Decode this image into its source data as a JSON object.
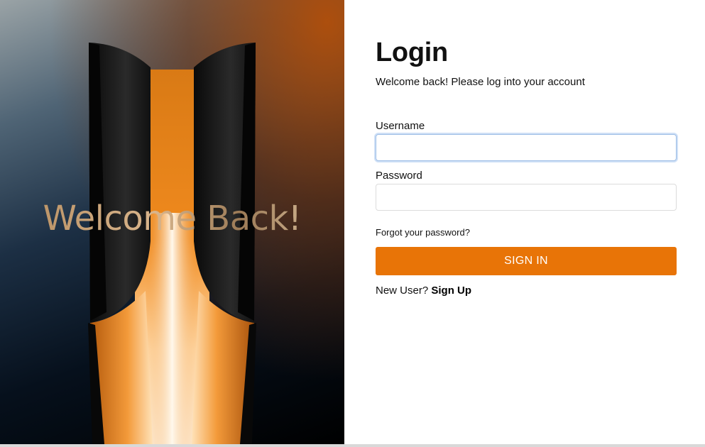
{
  "hero": {
    "title": "Welcome Back!"
  },
  "login": {
    "title": "Login",
    "subtitle": "Welcome back! Please log into your account",
    "username_label": "Username",
    "username_value": "",
    "password_label": "Password",
    "password_value": "",
    "forgot_link": "Forgot your password?",
    "signin_button": "SIGN IN",
    "new_user_text": "New User?",
    "signup_link": "Sign Up"
  },
  "colors": {
    "accent": "#e87407",
    "focus_ring": "#9cbde6",
    "text": "#111111"
  }
}
